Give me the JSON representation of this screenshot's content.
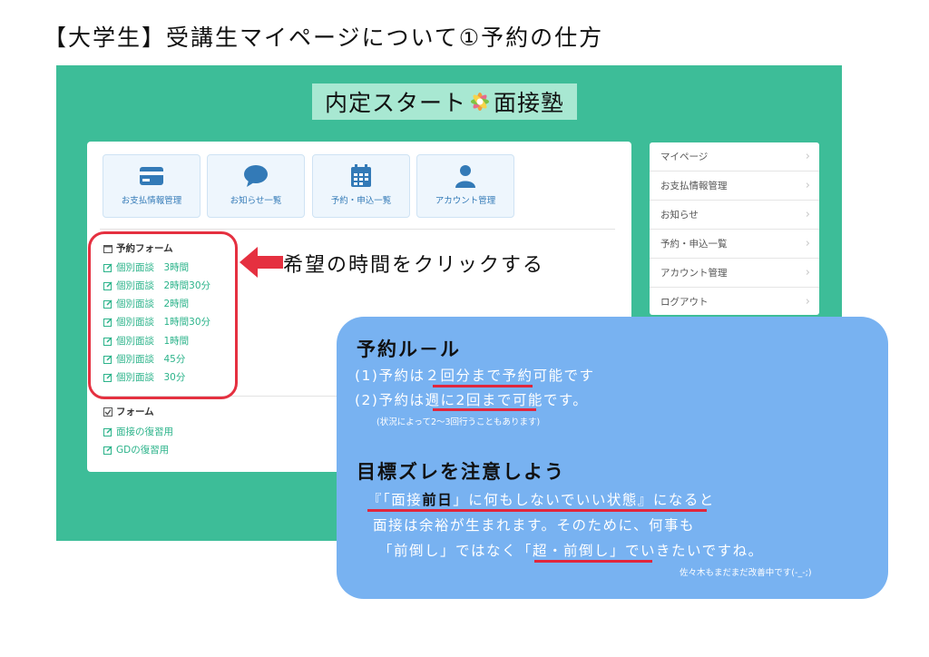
{
  "doc_title": "【大学生】受講生マイページについて①予約の仕方",
  "brand": {
    "prefix": "内定スタート",
    "logo_icon": "flower-logo-icon",
    "suffix": "面接塾"
  },
  "tiles": [
    {
      "label": "お支払情報管理",
      "icon": "credit-card-icon"
    },
    {
      "label": "お知らせ一覧",
      "icon": "speech-bubble-icon"
    },
    {
      "label": "予約・申込一覧",
      "icon": "calendar-icon"
    },
    {
      "label": "アカウント管理",
      "icon": "user-icon"
    }
  ],
  "reservation_form": {
    "heading": "予約フォーム",
    "items": [
      "個別面談　3時間",
      "個別面談　2時間30分",
      "個別面談　2時間",
      "個別面談　1時間30分",
      "個別面談　1時間",
      "個別面談　45分",
      "個別面談　30分"
    ]
  },
  "form_section": {
    "heading": "フォーム",
    "items": [
      "面接の復習用",
      "GDの復習用"
    ]
  },
  "callout": "希望の時間をクリックする",
  "sidebar": [
    "マイページ",
    "お支払情報管理",
    "お知らせ",
    "予約・申込一覧",
    "アカウント管理",
    "ログアウト"
  ],
  "rules": {
    "heading": "予約ル－ル",
    "line1": {
      "a": "(1)予約は",
      "b": "２回分まで",
      "c": "予約可能です"
    },
    "line2": {
      "a": "(2)予約は",
      "b": "週に2回まで",
      "c": "可能です。"
    },
    "note": "(状況によって2〜3回行うこともあります)"
  },
  "goal": {
    "heading": "目標ズレを注意しよう",
    "line1": {
      "a": "『「面接",
      "b": "前日",
      "c": "」に何もしないでいい状態』",
      "d": "になると"
    },
    "line2": "面接は余裕が生まれます。そのために、何事も",
    "line3": {
      "a": "「前倒し」ではなく",
      "b": "「超・前倒し」",
      "c": "でいきたいですね。"
    },
    "note": "佐々木もまだまだ改善中です(-_-;)"
  },
  "colors": {
    "frame": "#3dbd98",
    "link": "#2bb38a",
    "bubble": "#78b2f1",
    "highlight": "#e1263c"
  }
}
